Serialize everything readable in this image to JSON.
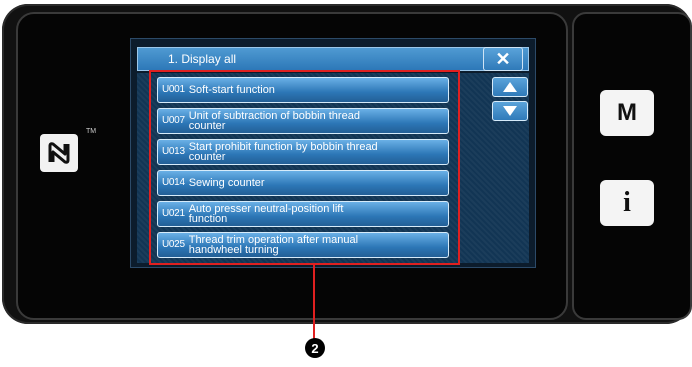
{
  "window": {
    "title": "1.   Display all",
    "close_symbol": "✕"
  },
  "items": [
    {
      "code": "U001",
      "label": "Soft-start function"
    },
    {
      "code": "U007",
      "label": "Unit of subtraction of bobbin thread\ncounter"
    },
    {
      "code": "U013",
      "label": "Start prohibit function by bobbin thread\ncounter"
    },
    {
      "code": "U014",
      "label": "Sewing counter"
    },
    {
      "code": "U021",
      "label": "Auto presser neutral-position lift\nfunction"
    },
    {
      "code": "U025",
      "label": "Thread trim operation after manual\nhandwheel turning"
    }
  ],
  "side_buttons": {
    "m_label": "M",
    "info_label": "i"
  },
  "nfc": {
    "trademark": "TM"
  },
  "callout": {
    "number": "2"
  },
  "colors": {
    "highlight": "#e02020",
    "button_blue": "#2c76b6"
  }
}
